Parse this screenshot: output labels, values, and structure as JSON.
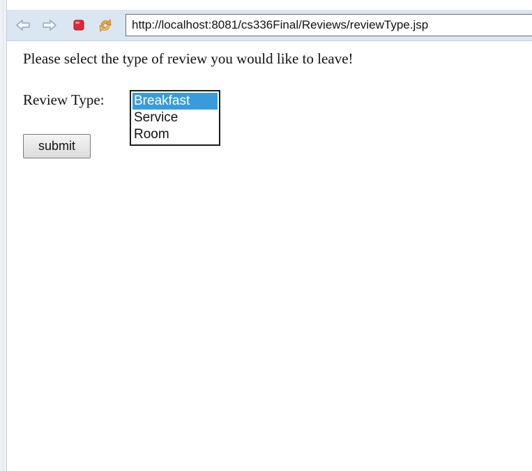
{
  "browser": {
    "url": "http://localhost:8081/cs336Final/Reviews/reviewType.jsp",
    "icons": {
      "back": "back-arrow-icon",
      "forward": "forward-arrow-icon",
      "stop": "stop-icon",
      "refresh": "refresh-icon"
    },
    "colors": {
      "stop_red": "#e0283a",
      "refresh_orange": "#f2a93b",
      "arrow_gray": "#9aa6b2"
    }
  },
  "page": {
    "prompt": "Please select the type of review you would like to leave!",
    "review_type_label": "Review Type:",
    "review_type_options": [
      {
        "label": "Breakfast",
        "selected": true
      },
      {
        "label": "Service",
        "selected": false
      },
      {
        "label": "Room",
        "selected": false
      }
    ],
    "submit_label": "submit",
    "selection_color": "#3a9bdc"
  }
}
